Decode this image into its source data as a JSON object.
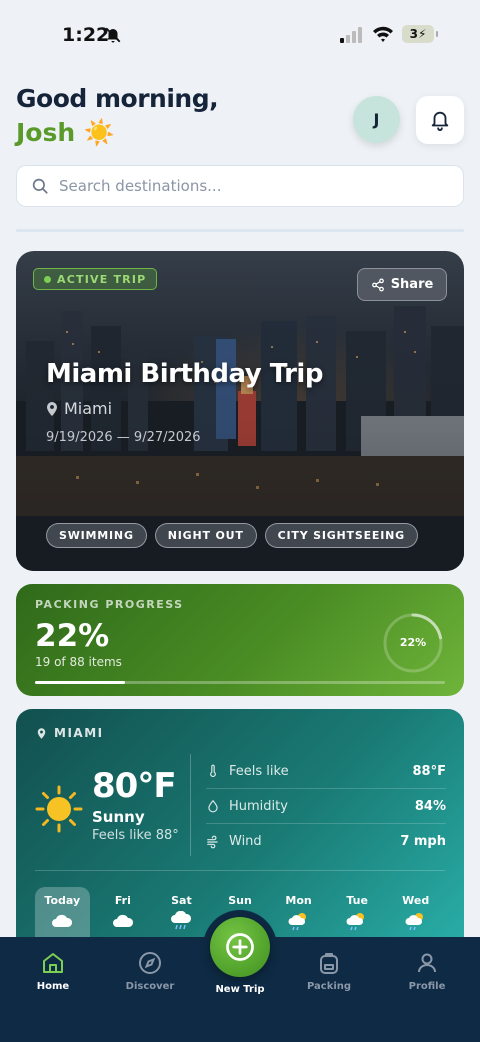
{
  "status_bar": {
    "time": "1:22",
    "battery": "3"
  },
  "header": {
    "greeting": "Good morning,",
    "name": "Josh",
    "name_emoji": "☀️",
    "avatar_initial": "J"
  },
  "search": {
    "placeholder": "Search destinations..."
  },
  "trip": {
    "badge": "ACTIVE TRIP",
    "share_label": "Share",
    "title": "Miami Birthday Trip",
    "location": "Miami",
    "dates": "9/19/2026 — 9/27/2026",
    "tags": [
      "SWIMMING",
      "NIGHT OUT",
      "CITY SIGHTSEEING"
    ]
  },
  "packing": {
    "label": "PACKING PROGRESS",
    "percent_text": "22%",
    "items_text": "19 of 88 items",
    "progress": 0.22,
    "ring_text": "22%"
  },
  "weather": {
    "location": "MIAMI",
    "temp": "80°F",
    "condition": "Sunny",
    "feels_like_short": "Feels like 88°",
    "rows": [
      {
        "label": "Feels like",
        "value": "88°F",
        "icon": "thermometer-icon"
      },
      {
        "label": "Humidity",
        "value": "84%",
        "icon": "droplet-icon"
      },
      {
        "label": "Wind",
        "value": "7 mph",
        "icon": "wind-icon"
      }
    ],
    "forecast": [
      {
        "day": "Today",
        "icon": "cloud"
      },
      {
        "day": "Fri",
        "icon": "cloud"
      },
      {
        "day": "Sat",
        "icon": "rain"
      },
      {
        "day": "Sun",
        "icon": "cloud"
      },
      {
        "day": "Mon",
        "icon": "partly-sunny"
      },
      {
        "day": "Tue",
        "icon": "partly-sunny"
      },
      {
        "day": "Wed",
        "icon": "partly-sunny"
      }
    ]
  },
  "nav": {
    "home": "Home",
    "discover": "Discover",
    "new_trip": "New Trip",
    "packing": "Packing",
    "profile": "Profile"
  },
  "colors": {
    "accent_green": "#5a9a2a",
    "nav_bg": "#0e2a44",
    "weather_teal": "#1a7a74"
  }
}
